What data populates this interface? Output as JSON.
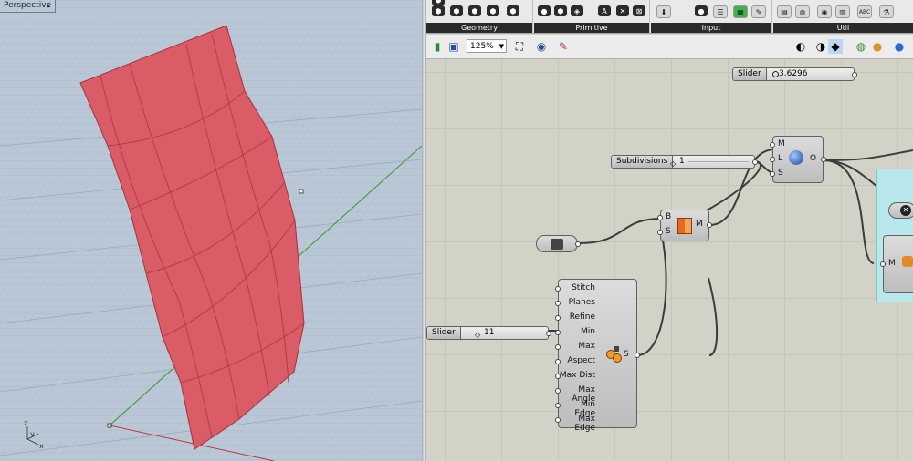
{
  "viewport": {
    "title": "Perspective",
    "dropdown_glyph": "▾",
    "axis_labels": {
      "z": "z",
      "y": "y",
      "x": "x"
    }
  },
  "ribbon": {
    "groups": [
      "Geometry",
      "Primitive",
      "Input",
      "Util"
    ]
  },
  "toolbar": {
    "zoom_value": "125%"
  },
  "canvas": {
    "slider_top": {
      "label": "Slider",
      "value": "3.6296"
    },
    "subdivisions": {
      "label": "Subdivisions",
      "value": "1"
    },
    "slider_left": {
      "label": "Slider",
      "value": "11"
    },
    "merge_component": {
      "inputs": [
        "M",
        "L",
        "S"
      ],
      "output": "O"
    },
    "brep_component": {
      "inputs": [
        "B",
        "S"
      ],
      "output": "M"
    },
    "mesh_settings": {
      "inputs": [
        "Stitch",
        "Planes",
        "Refine",
        "Min",
        "Max",
        "Aspect",
        "Max Dist",
        "Max Angle",
        "Min Edge",
        "Max Edge"
      ],
      "output": "S"
    },
    "right_component": {
      "input": "M"
    }
  },
  "colors": {
    "surface_fill": "#d95c66",
    "surface_edge": "#a8303a",
    "viewport_bg": "#b9c7d6",
    "canvas_bg": "#d3d2c7"
  }
}
